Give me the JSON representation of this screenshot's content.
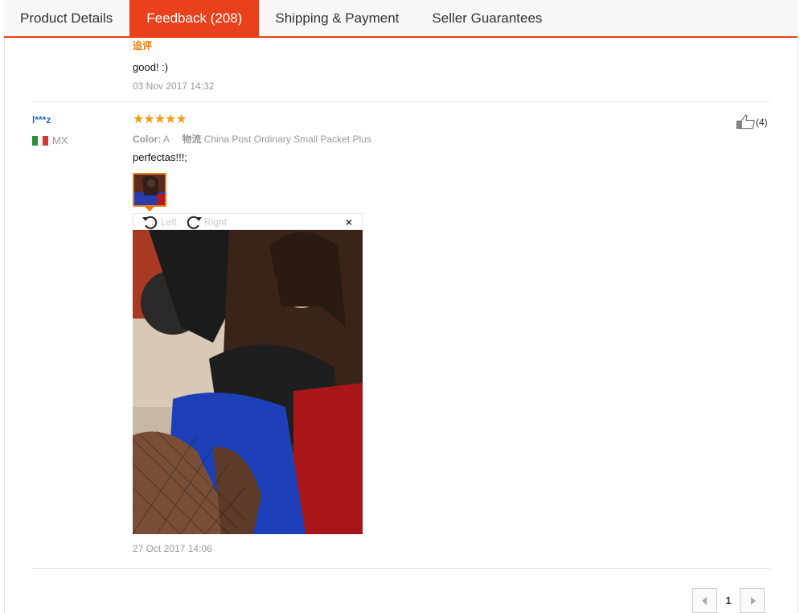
{
  "tabs": [
    {
      "label": "Product Details",
      "active": false
    },
    {
      "label": "Feedback (208)",
      "active": true
    },
    {
      "label": "Shipping & Payment",
      "active": false
    },
    {
      "label": "Seller Guarantees",
      "active": false
    }
  ],
  "review_prev": {
    "additional_label": "追评",
    "text": "good! :)",
    "date": "03 Nov 2017 14:32"
  },
  "review": {
    "user": "l***z",
    "country": "MX",
    "rating": 5,
    "attr_color_label": "Color:",
    "attr_color_value": "A",
    "attr_logistics_label": "物流",
    "attr_logistics_value": "China Post Ordinary Small Packet Plus",
    "helpful_count": "(4)",
    "text": "perfectas!!!;",
    "viewer_left": "Left",
    "viewer_right": "Right",
    "viewer_close": "×",
    "date": "27 Oct 2017 14:06"
  },
  "pagination": {
    "current": "1"
  },
  "colors": {
    "accent": "#e8411b",
    "star": "#f39b12",
    "link": "#1a6ec8"
  }
}
